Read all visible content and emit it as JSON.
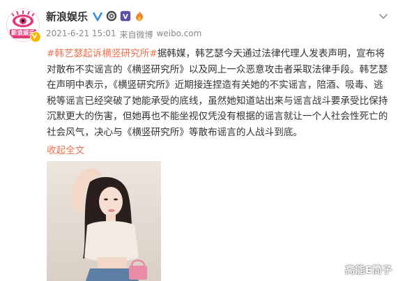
{
  "post": {
    "username": "新浪娱乐",
    "timestamp": "2021-6-21 15:01",
    "source_prefix": "来自",
    "source_name": "微博",
    "source_domain": "weibo.com",
    "hashtag": "#韩艺瑟起诉横竖研究所#",
    "body": "据韩媒，韩艺瑟今天通过法律代理人发表声明，宣布将对散布不实谣言的《横竖研究所》以及网上一众恶意攻击者采取法律手段。韩艺瑟在声明中表示，《横竖研究所》近期接连捏造有关她的不实谣言，陪酒、吸毒、逃税等谣言已经突破了她能承受的底线，虽然她知道站出来与谣言战斗要承受比保持沉默更大的伤害，但她再也不能坐视仅凭没有根据的谣言就让一个人社会性死亡的社会风气，决心与《横竖研究所》等散布谣言的人战斗到底。",
    "expand_label": "收起全文",
    "avatar_text": "新浪娱乐"
  },
  "watermark": "高能E筒子",
  "colors": {
    "link": "#eb7350",
    "text": "#333333",
    "meta": "#888888",
    "avatar_pink": "#e4397a",
    "verified": "#f7b500"
  },
  "icons": {
    "verified": "verified-v-icon",
    "level": "level-badge-icon",
    "vip": "vip-badge-icon",
    "fan": "fan-badge-icon",
    "more": "chevron-down-icon"
  }
}
